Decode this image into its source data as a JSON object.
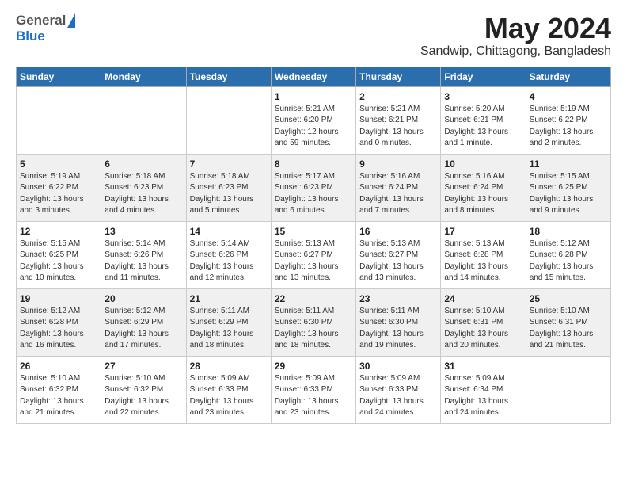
{
  "header": {
    "logo_general": "General",
    "logo_blue": "Blue",
    "month": "May 2024",
    "location": "Sandwip, Chittagong, Bangladesh"
  },
  "days_of_week": [
    "Sunday",
    "Monday",
    "Tuesday",
    "Wednesday",
    "Thursday",
    "Friday",
    "Saturday"
  ],
  "weeks": [
    [
      {
        "day": "",
        "info": ""
      },
      {
        "day": "",
        "info": ""
      },
      {
        "day": "",
        "info": ""
      },
      {
        "day": "1",
        "info": "Sunrise: 5:21 AM\nSunset: 6:20 PM\nDaylight: 12 hours\nand 59 minutes."
      },
      {
        "day": "2",
        "info": "Sunrise: 5:21 AM\nSunset: 6:21 PM\nDaylight: 13 hours\nand 0 minutes."
      },
      {
        "day": "3",
        "info": "Sunrise: 5:20 AM\nSunset: 6:21 PM\nDaylight: 13 hours\nand 1 minute."
      },
      {
        "day": "4",
        "info": "Sunrise: 5:19 AM\nSunset: 6:22 PM\nDaylight: 13 hours\nand 2 minutes."
      }
    ],
    [
      {
        "day": "5",
        "info": "Sunrise: 5:19 AM\nSunset: 6:22 PM\nDaylight: 13 hours\nand 3 minutes."
      },
      {
        "day": "6",
        "info": "Sunrise: 5:18 AM\nSunset: 6:23 PM\nDaylight: 13 hours\nand 4 minutes."
      },
      {
        "day": "7",
        "info": "Sunrise: 5:18 AM\nSunset: 6:23 PM\nDaylight: 13 hours\nand 5 minutes."
      },
      {
        "day": "8",
        "info": "Sunrise: 5:17 AM\nSunset: 6:23 PM\nDaylight: 13 hours\nand 6 minutes."
      },
      {
        "day": "9",
        "info": "Sunrise: 5:16 AM\nSunset: 6:24 PM\nDaylight: 13 hours\nand 7 minutes."
      },
      {
        "day": "10",
        "info": "Sunrise: 5:16 AM\nSunset: 6:24 PM\nDaylight: 13 hours\nand 8 minutes."
      },
      {
        "day": "11",
        "info": "Sunrise: 5:15 AM\nSunset: 6:25 PM\nDaylight: 13 hours\nand 9 minutes."
      }
    ],
    [
      {
        "day": "12",
        "info": "Sunrise: 5:15 AM\nSunset: 6:25 PM\nDaylight: 13 hours\nand 10 minutes."
      },
      {
        "day": "13",
        "info": "Sunrise: 5:14 AM\nSunset: 6:26 PM\nDaylight: 13 hours\nand 11 minutes."
      },
      {
        "day": "14",
        "info": "Sunrise: 5:14 AM\nSunset: 6:26 PM\nDaylight: 13 hours\nand 12 minutes."
      },
      {
        "day": "15",
        "info": "Sunrise: 5:13 AM\nSunset: 6:27 PM\nDaylight: 13 hours\nand 13 minutes."
      },
      {
        "day": "16",
        "info": "Sunrise: 5:13 AM\nSunset: 6:27 PM\nDaylight: 13 hours\nand 13 minutes."
      },
      {
        "day": "17",
        "info": "Sunrise: 5:13 AM\nSunset: 6:28 PM\nDaylight: 13 hours\nand 14 minutes."
      },
      {
        "day": "18",
        "info": "Sunrise: 5:12 AM\nSunset: 6:28 PM\nDaylight: 13 hours\nand 15 minutes."
      }
    ],
    [
      {
        "day": "19",
        "info": "Sunrise: 5:12 AM\nSunset: 6:28 PM\nDaylight: 13 hours\nand 16 minutes."
      },
      {
        "day": "20",
        "info": "Sunrise: 5:12 AM\nSunset: 6:29 PM\nDaylight: 13 hours\nand 17 minutes."
      },
      {
        "day": "21",
        "info": "Sunrise: 5:11 AM\nSunset: 6:29 PM\nDaylight: 13 hours\nand 18 minutes."
      },
      {
        "day": "22",
        "info": "Sunrise: 5:11 AM\nSunset: 6:30 PM\nDaylight: 13 hours\nand 18 minutes."
      },
      {
        "day": "23",
        "info": "Sunrise: 5:11 AM\nSunset: 6:30 PM\nDaylight: 13 hours\nand 19 minutes."
      },
      {
        "day": "24",
        "info": "Sunrise: 5:10 AM\nSunset: 6:31 PM\nDaylight: 13 hours\nand 20 minutes."
      },
      {
        "day": "25",
        "info": "Sunrise: 5:10 AM\nSunset: 6:31 PM\nDaylight: 13 hours\nand 21 minutes."
      }
    ],
    [
      {
        "day": "26",
        "info": "Sunrise: 5:10 AM\nSunset: 6:32 PM\nDaylight: 13 hours\nand 21 minutes."
      },
      {
        "day": "27",
        "info": "Sunrise: 5:10 AM\nSunset: 6:32 PM\nDaylight: 13 hours\nand 22 minutes."
      },
      {
        "day": "28",
        "info": "Sunrise: 5:09 AM\nSunset: 6:33 PM\nDaylight: 13 hours\nand 23 minutes."
      },
      {
        "day": "29",
        "info": "Sunrise: 5:09 AM\nSunset: 6:33 PM\nDaylight: 13 hours\nand 23 minutes."
      },
      {
        "day": "30",
        "info": "Sunrise: 5:09 AM\nSunset: 6:33 PM\nDaylight: 13 hours\nand 24 minutes."
      },
      {
        "day": "31",
        "info": "Sunrise: 5:09 AM\nSunset: 6:34 PM\nDaylight: 13 hours\nand 24 minutes."
      },
      {
        "day": "",
        "info": ""
      }
    ]
  ]
}
